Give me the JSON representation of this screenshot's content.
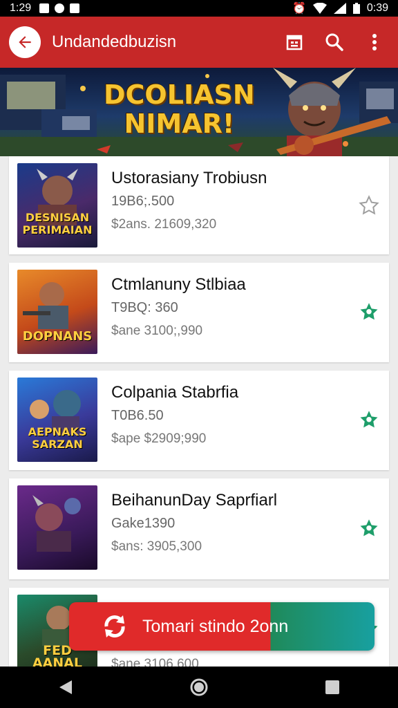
{
  "status_bar": {
    "time": "1:29",
    "clock": "0:39"
  },
  "app_bar": {
    "title": "Undandedbuzisn"
  },
  "banner": {
    "line1": "DCOLIASN",
    "line2": "NIMAR!"
  },
  "items": [
    {
      "name": "Ustorasiany Trobiusn",
      "sub": "19B6;.500",
      "price": "$2ans. 21609,320",
      "thumb_text": "DESNISAN PERIMAIAN",
      "starred": false
    },
    {
      "name": "Ctmlanuny Stlbiaa",
      "sub": "T9BQ: 360",
      "price": "$ane 3100;,990",
      "thumb_text": "DOPNANS",
      "starred": true
    },
    {
      "name": "Colpania Stabrfia",
      "sub": "T0B6.50",
      "price": "$ape $2909;990",
      "thumb_text": "AEPNAKS SARZAN",
      "starred": true
    },
    {
      "name": "BeihanunDay Saprfiarl",
      "sub": "Gake1390",
      "price": "$ans: 3905,300",
      "thumb_text": "",
      "starred": true
    },
    {
      "name": "",
      "sub": "",
      "price": "$ane 3106,600",
      "thumb_text": "FED AANAL",
      "starred": true
    }
  ],
  "toast": {
    "text": "Tomari stindo 2onn"
  },
  "colors": {
    "primary": "#c62828",
    "star_active": "#1e9e6a",
    "star_inactive": "#9e9e9e"
  }
}
